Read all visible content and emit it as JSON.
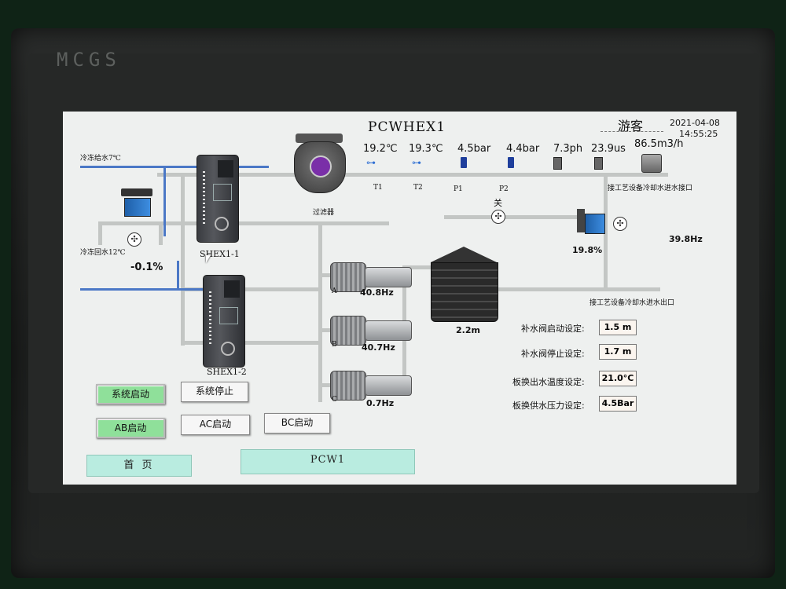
{
  "brand": "MCGS",
  "header": {
    "title": "PCWHEX1",
    "user": "游客",
    "date": "2021-04-08",
    "time": "14:55:25"
  },
  "pipes": {
    "chilled_supply_label": "冷冻给水7℃",
    "chilled_return_label": "冷冻回水12℃",
    "process_inlet_label": "接工艺设备冷却水进水接口",
    "process_outlet_label": "接工艺设备冷却水进水出口"
  },
  "sensors": {
    "t1": {
      "value": "19.2℃",
      "tag": "T1"
    },
    "t2": {
      "value": "19.3℃",
      "tag": "T2"
    },
    "p1": {
      "value": "4.5bar",
      "tag": "P1"
    },
    "p2": {
      "value": "4.4bar",
      "tag": "P2"
    },
    "ph": {
      "value": "7.3ph"
    },
    "conductivity": {
      "value": "23.9us"
    },
    "flow": {
      "value": "86.5m3/h"
    }
  },
  "equipment": {
    "filter_label": "过滤器",
    "shex1_label": "SHEX1-1",
    "shex2_label": "SHEX1-2",
    "left_valve_value": "-0.1%",
    "bypass_valve_state": "关",
    "right_valve_value": "19.8%",
    "right_freq": "39.8Hz",
    "tank_level": "2.2m",
    "pumps": [
      {
        "tag": "A",
        "freq": "40.8Hz"
      },
      {
        "tag": "B",
        "freq": "40.7Hz"
      },
      {
        "tag": "C",
        "freq": "0.7Hz"
      }
    ]
  },
  "settings": [
    {
      "label": "补水阀启动设定:",
      "value": "1.5 m"
    },
    {
      "label": "补水阀停止设定:",
      "value": "1.7 m"
    },
    {
      "label": "板换出水温度设定:",
      "value": "21.0°C"
    },
    {
      "label": "板换供水压力设定:",
      "value": "4.5Bar"
    }
  ],
  "controls": {
    "system_start": "系统启动",
    "system_stop": "系统停止",
    "ab_start": "AB启动",
    "ac_start": "AC启动",
    "bc_start": "BC启动"
  },
  "nav": {
    "home": "首 页",
    "pcw1": "PCW1"
  }
}
